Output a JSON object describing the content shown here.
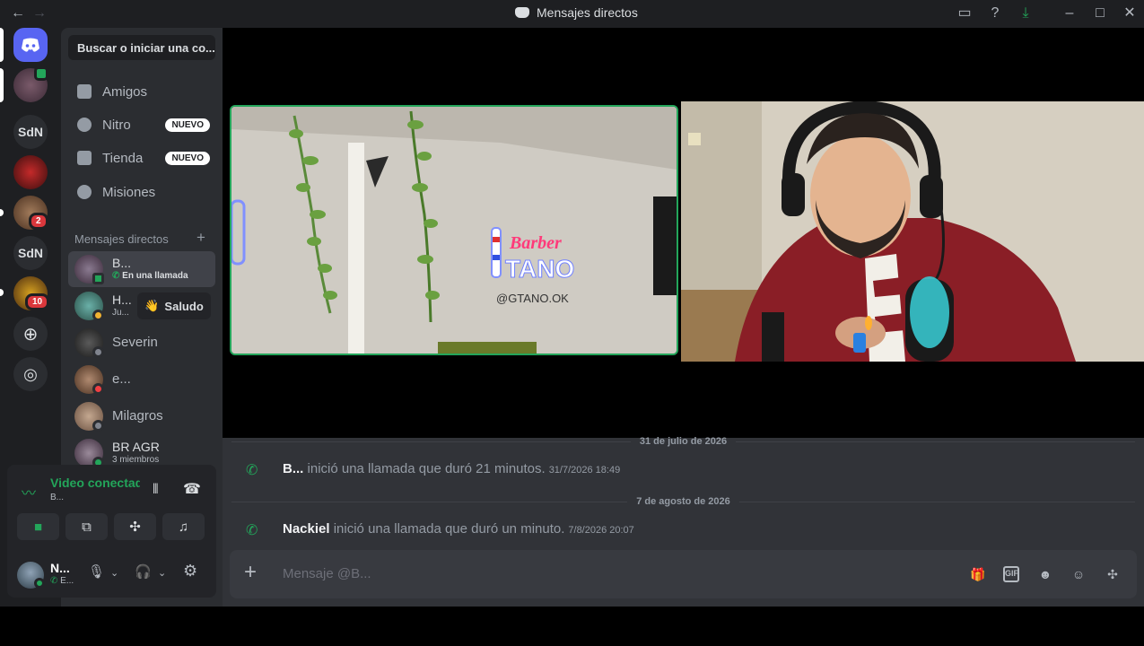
{
  "titlebar": {
    "title": "Mensajes directos"
  },
  "rail": {
    "servers": [
      {
        "label": ""
      },
      {
        "label": ""
      },
      {
        "label": "SdN"
      },
      {
        "label": ""
      },
      {
        "label": "",
        "badge": "2"
      },
      {
        "label": "SdN"
      },
      {
        "label": "",
        "badge": "10"
      }
    ]
  },
  "sidebar": {
    "search": "Buscar o iniciar una co...",
    "nav": [
      {
        "label": "Amigos"
      },
      {
        "label": "Nitro",
        "badge": "NUEVO"
      },
      {
        "label": "Tienda",
        "badge": "NUEVO"
      },
      {
        "label": "Misiones"
      }
    ],
    "dm_header": "Mensajes directos",
    "dms": [
      {
        "name": "B...",
        "sub": "En una llamada"
      },
      {
        "name": "H...",
        "sub": "Ju..."
      },
      {
        "name": "Severin"
      },
      {
        "name": "e..."
      },
      {
        "name": "Milagros"
      },
      {
        "name": "BR AGR",
        "sub": "3 miembros"
      }
    ],
    "saludo": "Saludo"
  },
  "voice": {
    "title": "Video conectado",
    "sub": "B..."
  },
  "user": {
    "name": "N...",
    "sub": "E..."
  },
  "chat": {
    "dates": [
      "31 de julio de 2026",
      "7 de agosto de 2026"
    ],
    "messages": [
      {
        "who": "B...",
        "text": "inició una llamada que duró 21 minutos.",
        "ts": "31/7/2026 18:49"
      },
      {
        "who": "Nackiel",
        "text": "inició una llamada que duró un minuto.",
        "ts": "7/8/2026 20:07"
      }
    ],
    "placeholder": "Mensaje @B...",
    "gif_label": "GIF"
  },
  "video": {
    "sign_line1": "Barber",
    "sign_line2": "TANO",
    "handle": "@GTANO.OK"
  },
  "colors": {
    "accent": "#5865f2",
    "online": "#23a55a",
    "danger": "#da373c"
  }
}
